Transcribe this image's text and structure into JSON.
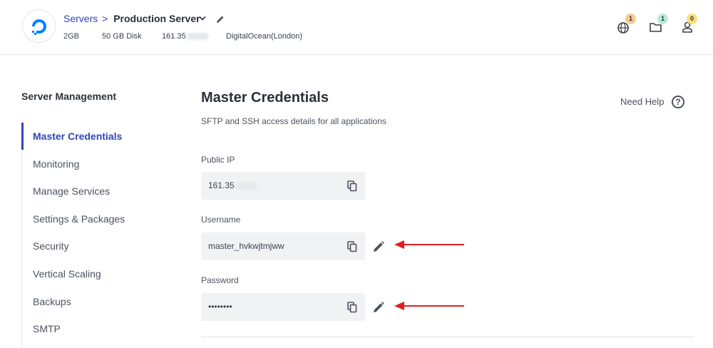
{
  "header": {
    "breadcrumb_servers": "Servers",
    "breadcrumb_sep": ">",
    "server_name": "Production Server",
    "meta": {
      "ram": "2GB",
      "disk": "50 GB Disk",
      "ip_partial": "161.35",
      "provider": "DigitalOcean(London)"
    },
    "icons": [
      {
        "name": "www-icon",
        "badge": "1",
        "badge_color": "#f6c98e"
      },
      {
        "name": "folder-icon",
        "badge": "1",
        "badge_color": "#b8ecd9"
      },
      {
        "name": "user-icon",
        "badge": "0",
        "badge_color": "#f7e27a"
      }
    ]
  },
  "sidebar": {
    "title": "Server Management",
    "items": [
      {
        "label": "Master Credentials",
        "active": true
      },
      {
        "label": "Monitoring"
      },
      {
        "label": "Manage Services"
      },
      {
        "label": "Settings & Packages"
      },
      {
        "label": "Security"
      },
      {
        "label": "Vertical Scaling"
      },
      {
        "label": "Backups"
      },
      {
        "label": "SMTP"
      }
    ]
  },
  "main": {
    "title": "Master Credentials",
    "subtitle": "SFTP and SSH access details for all applications",
    "help_label": "Need Help",
    "help_icon_glyph": "?",
    "fields": {
      "public_ip": {
        "label": "Public IP",
        "value": "161.35"
      },
      "username": {
        "label": "Username",
        "value": "master_hvkwjtmjww"
      },
      "password": {
        "label": "Password",
        "value": "••••••••"
      }
    }
  },
  "colors": {
    "accent": "#2f46b8",
    "arrow": "#e02020",
    "field_bg": "#f1f2f4"
  }
}
